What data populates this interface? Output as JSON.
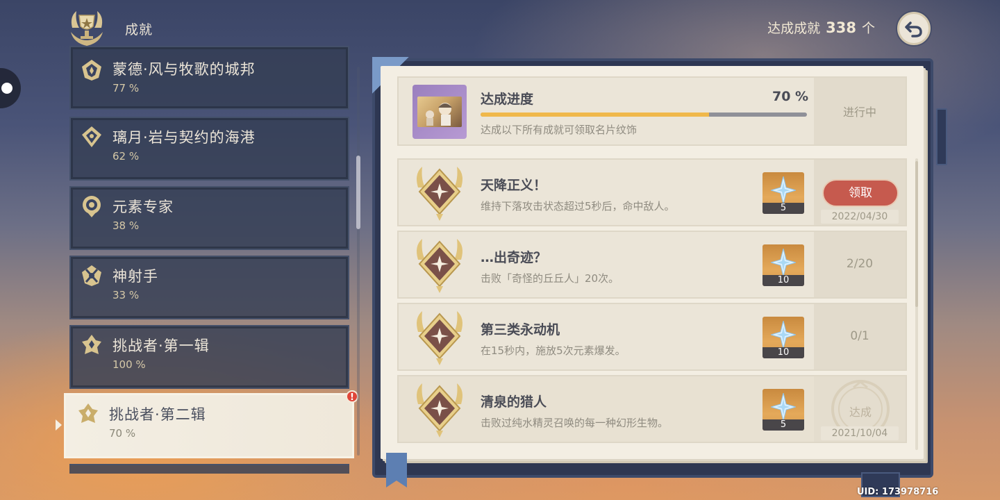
{
  "header": {
    "title": "成就",
    "achieved_label": "达成成就",
    "achieved_count": "338",
    "achieved_unit": "个",
    "back_icon": "back-arrow-icon"
  },
  "categories": [
    {
      "name": "蒙德·风与牧歌的城邦",
      "percent": "77 %"
    },
    {
      "name": "璃月·岩与契约的海港",
      "percent": "62 %"
    },
    {
      "name": "元素专家",
      "percent": "38 %"
    },
    {
      "name": "神射手",
      "percent": "33 %"
    },
    {
      "name": "挑战者·第一辑",
      "percent": "100 %"
    },
    {
      "name": "挑战者·第二辑",
      "percent": "70 %",
      "selected": true,
      "badge": "!"
    }
  ],
  "progress": {
    "title": "达成进度",
    "percent": "70 %",
    "fill_fraction": 0.7,
    "description": "达成以下所有成就可领取名片纹饰",
    "status": "进行中"
  },
  "achievements": [
    {
      "title": "天降正义！",
      "description": "维持下落攻击状态超过5秒后，命中敌人。",
      "reward_qty": "5",
      "action": "领取",
      "date": "2022/04/30"
    },
    {
      "title": "…出奇迹？",
      "description": "击败「奇怪的丘丘人」20次。",
      "reward_qty": "10",
      "progress": "2/20"
    },
    {
      "title": "第三类永动机",
      "description": "在15秒内，施放5次元素爆发。",
      "reward_qty": "10",
      "progress": "0/1"
    },
    {
      "title": "清泉的猎人",
      "description": "击败过纯水精灵召唤的每一种幻形生物。",
      "reward_qty": "5",
      "status": "达成",
      "date": "2021/10/04"
    }
  ],
  "uid": "UID: 173978716",
  "colors": {
    "accent_gold": "#f0b84b",
    "claim_red": "#c65a4e",
    "panel_dark": "#343e54",
    "page_cream": "#f3eee3"
  }
}
